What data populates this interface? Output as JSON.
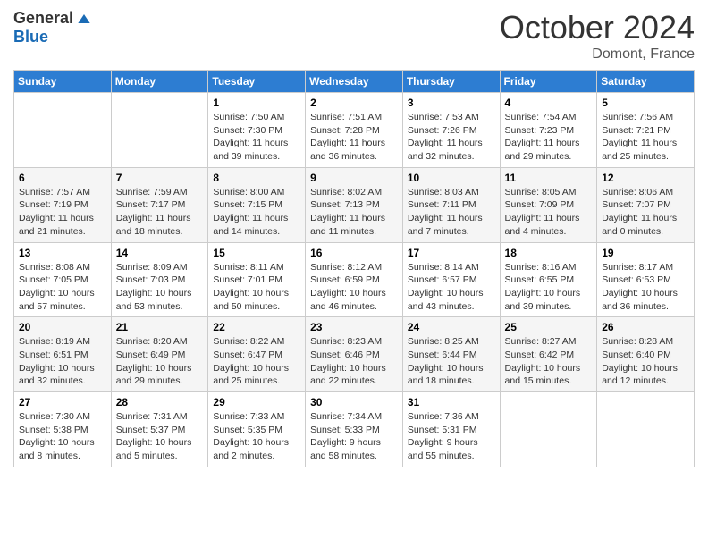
{
  "header": {
    "logo_general": "General",
    "logo_blue": "Blue",
    "month": "October 2024",
    "location": "Domont, France"
  },
  "weekdays": [
    "Sunday",
    "Monday",
    "Tuesday",
    "Wednesday",
    "Thursday",
    "Friday",
    "Saturday"
  ],
  "weeks": [
    [
      {
        "day": "",
        "info": ""
      },
      {
        "day": "",
        "info": ""
      },
      {
        "day": "1",
        "info": "Sunrise: 7:50 AM\nSunset: 7:30 PM\nDaylight: 11 hours and 39 minutes."
      },
      {
        "day": "2",
        "info": "Sunrise: 7:51 AM\nSunset: 7:28 PM\nDaylight: 11 hours and 36 minutes."
      },
      {
        "day": "3",
        "info": "Sunrise: 7:53 AM\nSunset: 7:26 PM\nDaylight: 11 hours and 32 minutes."
      },
      {
        "day": "4",
        "info": "Sunrise: 7:54 AM\nSunset: 7:23 PM\nDaylight: 11 hours and 29 minutes."
      },
      {
        "day": "5",
        "info": "Sunrise: 7:56 AM\nSunset: 7:21 PM\nDaylight: 11 hours and 25 minutes."
      }
    ],
    [
      {
        "day": "6",
        "info": "Sunrise: 7:57 AM\nSunset: 7:19 PM\nDaylight: 11 hours and 21 minutes."
      },
      {
        "day": "7",
        "info": "Sunrise: 7:59 AM\nSunset: 7:17 PM\nDaylight: 11 hours and 18 minutes."
      },
      {
        "day": "8",
        "info": "Sunrise: 8:00 AM\nSunset: 7:15 PM\nDaylight: 11 hours and 14 minutes."
      },
      {
        "day": "9",
        "info": "Sunrise: 8:02 AM\nSunset: 7:13 PM\nDaylight: 11 hours and 11 minutes."
      },
      {
        "day": "10",
        "info": "Sunrise: 8:03 AM\nSunset: 7:11 PM\nDaylight: 11 hours and 7 minutes."
      },
      {
        "day": "11",
        "info": "Sunrise: 8:05 AM\nSunset: 7:09 PM\nDaylight: 11 hours and 4 minutes."
      },
      {
        "day": "12",
        "info": "Sunrise: 8:06 AM\nSunset: 7:07 PM\nDaylight: 11 hours and 0 minutes."
      }
    ],
    [
      {
        "day": "13",
        "info": "Sunrise: 8:08 AM\nSunset: 7:05 PM\nDaylight: 10 hours and 57 minutes."
      },
      {
        "day": "14",
        "info": "Sunrise: 8:09 AM\nSunset: 7:03 PM\nDaylight: 10 hours and 53 minutes."
      },
      {
        "day": "15",
        "info": "Sunrise: 8:11 AM\nSunset: 7:01 PM\nDaylight: 10 hours and 50 minutes."
      },
      {
        "day": "16",
        "info": "Sunrise: 8:12 AM\nSunset: 6:59 PM\nDaylight: 10 hours and 46 minutes."
      },
      {
        "day": "17",
        "info": "Sunrise: 8:14 AM\nSunset: 6:57 PM\nDaylight: 10 hours and 43 minutes."
      },
      {
        "day": "18",
        "info": "Sunrise: 8:16 AM\nSunset: 6:55 PM\nDaylight: 10 hours and 39 minutes."
      },
      {
        "day": "19",
        "info": "Sunrise: 8:17 AM\nSunset: 6:53 PM\nDaylight: 10 hours and 36 minutes."
      }
    ],
    [
      {
        "day": "20",
        "info": "Sunrise: 8:19 AM\nSunset: 6:51 PM\nDaylight: 10 hours and 32 minutes."
      },
      {
        "day": "21",
        "info": "Sunrise: 8:20 AM\nSunset: 6:49 PM\nDaylight: 10 hours and 29 minutes."
      },
      {
        "day": "22",
        "info": "Sunrise: 8:22 AM\nSunset: 6:47 PM\nDaylight: 10 hours and 25 minutes."
      },
      {
        "day": "23",
        "info": "Sunrise: 8:23 AM\nSunset: 6:46 PM\nDaylight: 10 hours and 22 minutes."
      },
      {
        "day": "24",
        "info": "Sunrise: 8:25 AM\nSunset: 6:44 PM\nDaylight: 10 hours and 18 minutes."
      },
      {
        "day": "25",
        "info": "Sunrise: 8:27 AM\nSunset: 6:42 PM\nDaylight: 10 hours and 15 minutes."
      },
      {
        "day": "26",
        "info": "Sunrise: 8:28 AM\nSunset: 6:40 PM\nDaylight: 10 hours and 12 minutes."
      }
    ],
    [
      {
        "day": "27",
        "info": "Sunrise: 7:30 AM\nSunset: 5:38 PM\nDaylight: 10 hours and 8 minutes."
      },
      {
        "day": "28",
        "info": "Sunrise: 7:31 AM\nSunset: 5:37 PM\nDaylight: 10 hours and 5 minutes."
      },
      {
        "day": "29",
        "info": "Sunrise: 7:33 AM\nSunset: 5:35 PM\nDaylight: 10 hours and 2 minutes."
      },
      {
        "day": "30",
        "info": "Sunrise: 7:34 AM\nSunset: 5:33 PM\nDaylight: 9 hours and 58 minutes."
      },
      {
        "day": "31",
        "info": "Sunrise: 7:36 AM\nSunset: 5:31 PM\nDaylight: 9 hours and 55 minutes."
      },
      {
        "day": "",
        "info": ""
      },
      {
        "day": "",
        "info": ""
      }
    ]
  ]
}
